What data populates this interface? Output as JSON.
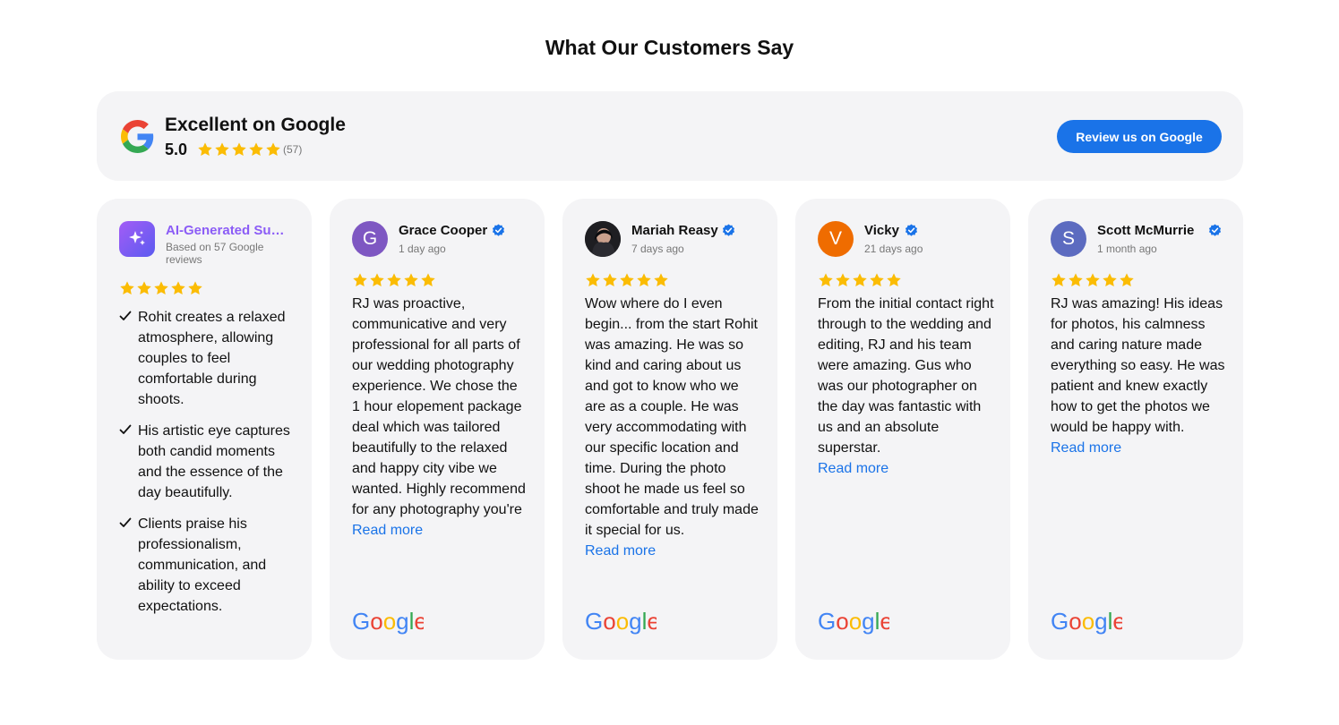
{
  "page": {
    "title": "What Our Customers Say"
  },
  "summary": {
    "title": "Excellent on Google",
    "score": "5.0",
    "count": "(57)",
    "stars": 5,
    "button_label": "Review us on Google"
  },
  "ai_summary": {
    "title": "AI-Generated Summary",
    "subtitle": "Based on 57 Google reviews",
    "stars": 5,
    "points": [
      "Rohit creates a relaxed atmosphere, allowing couples to feel comfortable during shoots.",
      "His artistic eye captures both candid moments and the essence of the day beautifully.",
      "Clients praise his professionalism, communication, and ability to exceed expectations."
    ]
  },
  "reviews": [
    {
      "name": "Grace Cooper",
      "initial": "G",
      "avatar_color": "#7e57c2",
      "date": "1 day ago",
      "stars": 5,
      "text": "RJ was proactive, communicative and very professional for all parts of our wedding photography experience. We chose the 1 hour elopement package deal which was tailored beautifully to the relaxed and happy city vibe we wanted. Highly recommend for any photography you're",
      "read_more": "Read more"
    },
    {
      "name": "Mariah Reasy",
      "initial": "",
      "avatar_color": "#1e1e22",
      "date": "7 days ago",
      "stars": 5,
      "text": "Wow where do I even begin... from the start Rohit was amazing. He was so kind and caring about us and got to know who we are as a couple. He was very accommodating with our specific location and time. During the photo shoot he made us feel so comfortable and truly made it special for us.",
      "read_more": "Read more"
    },
    {
      "name": "Vicky",
      "initial": "V",
      "avatar_color": "#ef6c00",
      "date": "21 days ago",
      "stars": 5,
      "text": "From the initial contact right through to the wedding and editing, RJ and his team were amazing. Gus who was our photographer on the day was fantastic with us and an absolute superstar.",
      "read_more": "Read more"
    },
    {
      "name": "Scott McMurrie",
      "initial": "S",
      "avatar_color": "#5c6bc0",
      "date": "1 month ago",
      "stars": 5,
      "text": "RJ was amazing! His ideas for photos, his calmness and caring nature made everything so easy. He was patient and knew exactly how to get the photos we would be happy with.",
      "read_more": "Read more"
    }
  ],
  "colors": {
    "accent": "#1a73e8",
    "star": "#fbbc04",
    "card_bg": "#f4f4f6",
    "ai_title": "#8b5cf6"
  },
  "icons": [
    "google-g-icon",
    "star-icon",
    "verified-badge-icon",
    "sparkle-icon",
    "check-icon",
    "google-wordmark"
  ]
}
